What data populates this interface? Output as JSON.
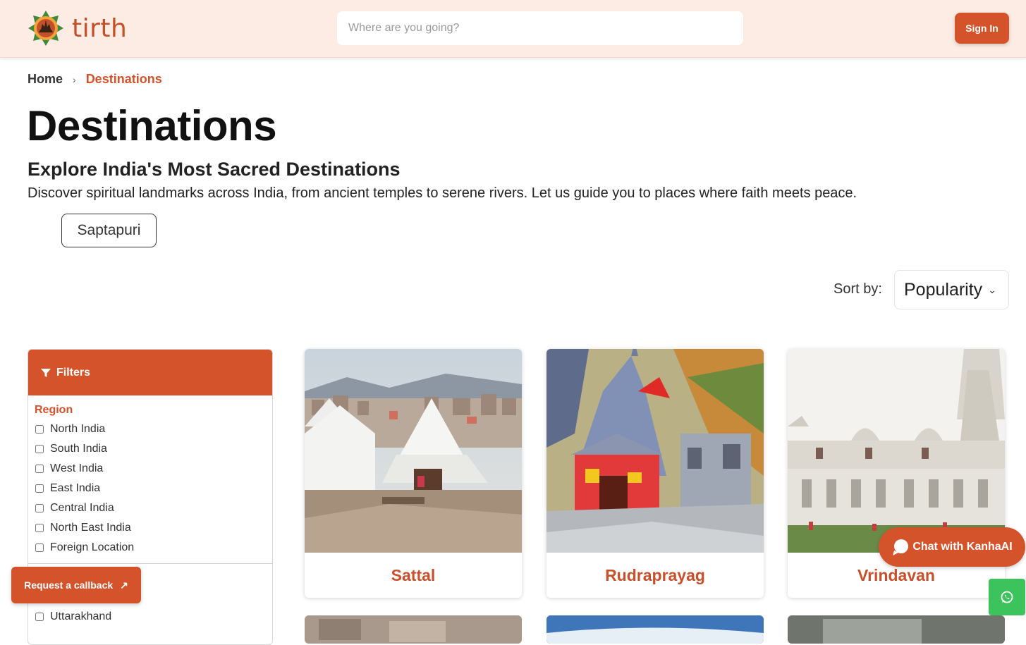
{
  "brand": {
    "name": "tirth",
    "accent": "#d4532b"
  },
  "header": {
    "search_placeholder": "Where are you going?",
    "signin_label": "Sign In"
  },
  "breadcrumb": {
    "home": "Home",
    "current": "Destinations"
  },
  "page": {
    "title": "Destinations",
    "subtitle": "Explore India's Most Sacred Destinations",
    "description": "Discover spiritual landmarks across India, from ancient temples to serene rivers. Let us guide you to places where faith meets peace.",
    "tag": "Saptapuri"
  },
  "sort": {
    "label": "Sort by:",
    "value": "Popularity"
  },
  "filters": {
    "title": "Filters",
    "region_title": "Region",
    "regions": [
      "North India",
      "South India",
      "West India",
      "East India",
      "Central India",
      "North East India",
      "Foreign Location"
    ],
    "second_group_item": "Uttarakhand"
  },
  "cards": [
    {
      "name": "Sattal"
    },
    {
      "name": "Rudraprayag"
    },
    {
      "name": "Vrindavan"
    }
  ],
  "floating": {
    "callback_label": "Request a callback",
    "chat_label": "Chat with KanhaAI"
  },
  "icons": {
    "logo": "lotus-temple-icon",
    "filter": "funnel-icon",
    "breadcrumb_sep": "chevron-right-icon",
    "sort_chevron": "chevron-down-icon",
    "callback_arrow": "arrow-up-right-icon",
    "chat": "chat-bubble-icon",
    "whatsapp": "whatsapp-icon"
  }
}
